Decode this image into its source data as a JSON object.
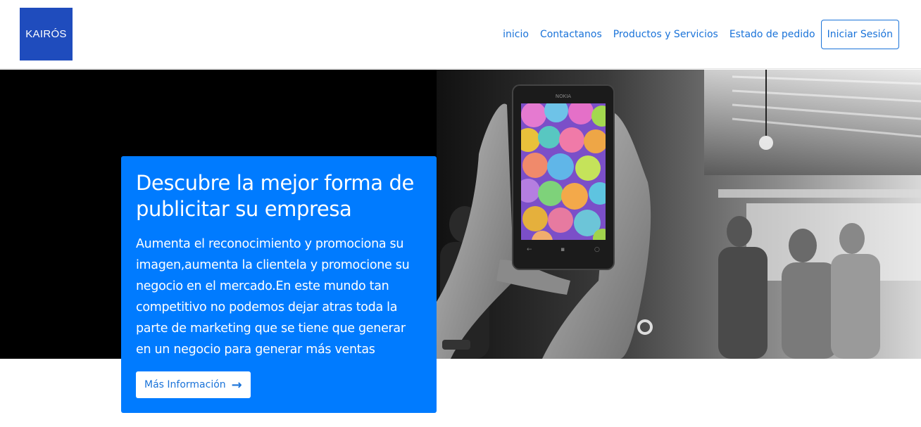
{
  "brand": {
    "logo_text": "KAIRÓS",
    "color": "#1f4cbd"
  },
  "nav": {
    "items": [
      "inicio",
      "Contactanos",
      "Productos y Servicios",
      "Estado de pedido"
    ],
    "login_label": "Iniciar Sesión",
    "link_color": "#1a73d9"
  },
  "hero": {
    "title": "Descubre la mejor forma de publicitar su empresa",
    "body": "Aumenta el reconocimiento y promociona su imagen,aumenta la clientela y promocione su negocio en el mercado.En este mundo tan competitivo no podemos dejar atras toda la parte de marketing que se tiene que generar en un negocio para generar más ventas",
    "button_label": "Más Información",
    "button_icon": "arrow-right-icon",
    "card_color": "#007bff",
    "phone_brand": "NOKIA"
  }
}
